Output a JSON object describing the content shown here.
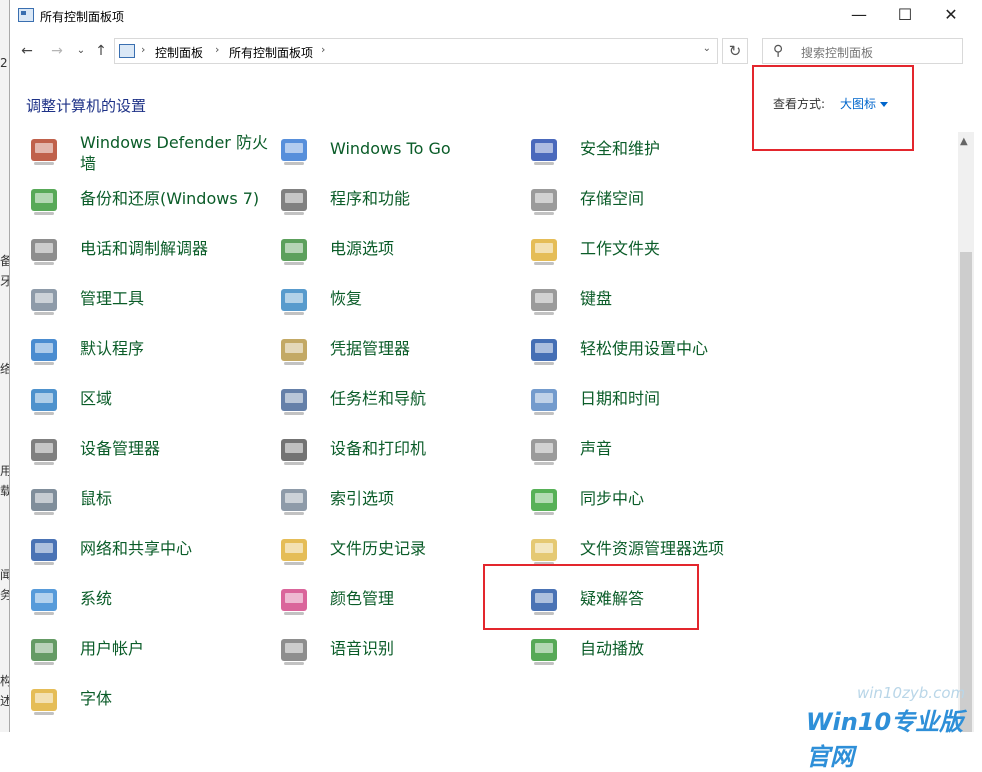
{
  "window": {
    "title": "所有控制面板项",
    "minimize": "—",
    "maximize": "☐",
    "close": "✕"
  },
  "nav": {
    "back": "←",
    "forward": "→",
    "recent": "⌄",
    "up": "↑"
  },
  "address": {
    "crumbs": [
      "控制面板",
      "所有控制面板项"
    ],
    "sep": "›",
    "dropdown": "⌄",
    "refresh": "↻"
  },
  "search": {
    "placeholder": "搜索控制面板",
    "icon": "⚲"
  },
  "header": {
    "title": "调整计算机的设置",
    "view_label": "查看方式:",
    "view_value": "大图标"
  },
  "bg_left": [
    "2",
    "备",
    "牙",
    "络",
    "用",
    "载",
    "闻",
    "务",
    "构",
    "述"
  ],
  "items": [
    {
      "label": "Windows Defender 防火墙",
      "icon": "firewall-icon",
      "color": "#b5452c"
    },
    {
      "label": "Windows To Go",
      "icon": "usb-drive-icon",
      "color": "#3a7bd5"
    },
    {
      "label": "安全和维护",
      "icon": "flag-icon",
      "color": "#2a4fb0"
    },
    {
      "label": "备份和还原(Windows 7)",
      "icon": "backup-icon",
      "color": "#3b9a3b"
    },
    {
      "label": "程序和功能",
      "icon": "programs-icon",
      "color": "#6b6b6b"
    },
    {
      "label": "存储空间",
      "icon": "storage-icon",
      "color": "#8a8a8a"
    },
    {
      "label": "电话和调制解调器",
      "icon": "phone-icon",
      "color": "#7a7a7a"
    },
    {
      "label": "电源选项",
      "icon": "battery-icon",
      "color": "#3f8f3f"
    },
    {
      "label": "工作文件夹",
      "icon": "work-folder-icon",
      "color": "#e0b13a"
    },
    {
      "label": "管理工具",
      "icon": "admin-tools-icon",
      "color": "#7a8a9a"
    },
    {
      "label": "恢复",
      "icon": "recovery-icon",
      "color": "#3b8ac4"
    },
    {
      "label": "键盘",
      "icon": "keyboard-icon",
      "color": "#8a8a8a"
    },
    {
      "label": "默认程序",
      "icon": "default-programs-icon",
      "color": "#2a78c8"
    },
    {
      "label": "凭据管理器",
      "icon": "credential-icon",
      "color": "#b89a4a"
    },
    {
      "label": "轻松使用设置中心",
      "icon": "ease-access-icon",
      "color": "#2456a8"
    },
    {
      "label": "区域",
      "icon": "globe-clock-icon",
      "color": "#2f7fc4"
    },
    {
      "label": "任务栏和导航",
      "icon": "taskbar-icon",
      "color": "#4a6a9a"
    },
    {
      "label": "日期和时间",
      "icon": "calendar-icon",
      "color": "#5a8ac4"
    },
    {
      "label": "设备管理器",
      "icon": "device-manager-icon",
      "color": "#6a6a6a"
    },
    {
      "label": "设备和打印机",
      "icon": "printer-icon",
      "color": "#5a5a5a"
    },
    {
      "label": "声音",
      "icon": "speaker-icon",
      "color": "#8a8a8a"
    },
    {
      "label": "鼠标",
      "icon": "mouse-icon",
      "color": "#6a7a8a"
    },
    {
      "label": "索引选项",
      "icon": "index-search-icon",
      "color": "#7a8a9a"
    },
    {
      "label": "同步中心",
      "icon": "sync-icon",
      "color": "#3aa33a"
    },
    {
      "label": "网络和共享中心",
      "icon": "network-icon",
      "color": "#2a5aa8"
    },
    {
      "label": "文件历史记录",
      "icon": "file-history-icon",
      "color": "#e0b13a"
    },
    {
      "label": "文件资源管理器选项",
      "icon": "folder-options-icon",
      "color": "#e0c05a"
    },
    {
      "label": "系统",
      "icon": "computer-icon",
      "color": "#3a8ad4"
    },
    {
      "label": "颜色管理",
      "icon": "color-management-icon",
      "color": "#d44a8a"
    },
    {
      "label": "疑难解答",
      "icon": "troubleshoot-icon",
      "color": "#2a5aa8"
    },
    {
      "label": "用户帐户",
      "icon": "user-accounts-icon",
      "color": "#4a8a4a"
    },
    {
      "label": "语音识别",
      "icon": "microphone-icon",
      "color": "#7a7a7a"
    },
    {
      "label": "自动播放",
      "icon": "autoplay-icon",
      "color": "#3a9a3a"
    },
    {
      "label": "字体",
      "icon": "fonts-icon",
      "color": "#e0b13a"
    }
  ],
  "watermark": {
    "url": "win10zyb.com",
    "brand": "Win10专业版官网"
  },
  "colors": {
    "link_green": "#0a5c28",
    "title_blue": "#1e3287",
    "accent_blue": "#0066cc",
    "highlight_red": "#e3262d"
  }
}
